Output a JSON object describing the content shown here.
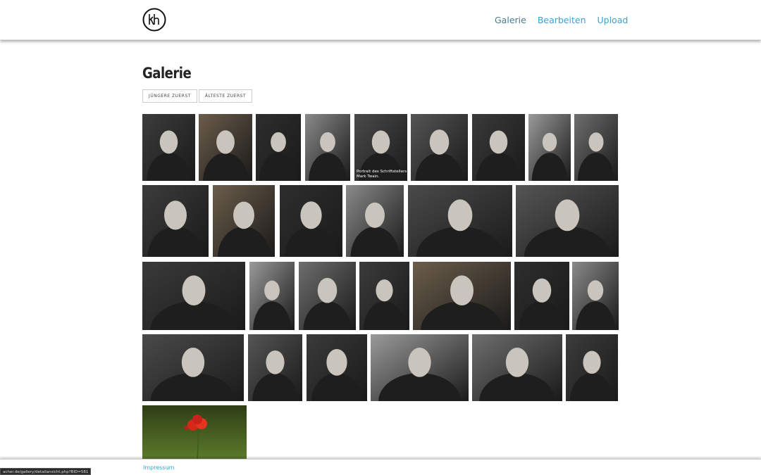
{
  "colors": {
    "link": "#3aa2cf",
    "nav_active": "#4a7a8c",
    "text": "#222222"
  },
  "header": {
    "logo_icon": "kh-monogram-logo-icon",
    "nav": [
      {
        "label": "Galerie",
        "active": true
      },
      {
        "label": "Bearbeiten",
        "active": false
      },
      {
        "label": "Upload",
        "active": false
      }
    ]
  },
  "page": {
    "title": "Galerie",
    "sort_newest": "JÜNGERE ZUERST",
    "sort_oldest": "ÄLTESTE ZUERST"
  },
  "gallery": {
    "hover_caption_line1": "Portrait des Schriftstellers",
    "hover_caption_line2": "Mark Twain.",
    "photos": [
      "man-in-suit-portrait",
      "einstein-portrait",
      "speaker-portrait",
      "standing-man-portrait",
      "mark-twain-portrait",
      "composer-portrait",
      "elderly-man-portrait",
      "man-on-stage",
      "crowd-scene",
      "bearded-man-portrait",
      "man-with-pipe-portrait",
      "man-with-beret",
      "man-with-glasses",
      "trumpet-player",
      "group-indoors",
      "signing-ceremony",
      "conductor-portrait",
      "politician-portrait",
      "runner-on-track",
      "guitar-duo",
      "actress-portrait",
      "gandhi-portrait",
      "man-speaking-at-mic",
      "singer-at-microphone",
      "leader-with-microphones",
      "young-man-with-cap",
      "einstein-with-group",
      "man-singing",
      "red-poppy-meadow"
    ]
  },
  "footer": {
    "impressum": "Impressum"
  },
  "statusbar": {
    "url": "acher.de/gallery/detailansicht.php?BID=581"
  }
}
